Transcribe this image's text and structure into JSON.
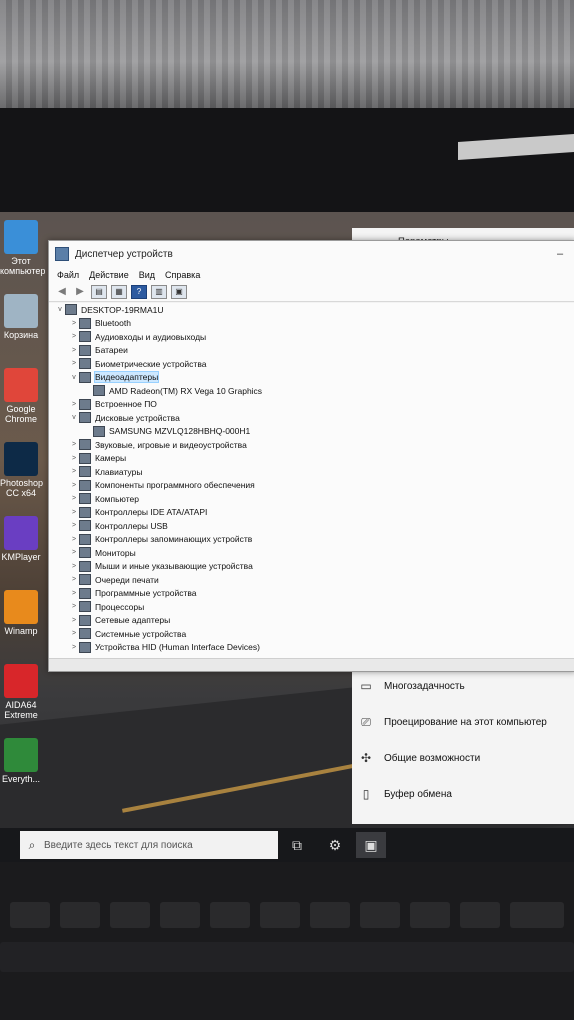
{
  "desktop": {
    "icons": [
      {
        "label": "Этот компьютер",
        "icon": "computer-icon",
        "color": "#3a8fd8"
      },
      {
        "label": "Корзина",
        "icon": "recycle-bin-icon",
        "color": "#9fb4c4"
      },
      {
        "label": "Google Chrome",
        "icon": "chrome-icon",
        "color": "#e0463a"
      },
      {
        "label": "Photoshop CC x64",
        "icon": "photoshop-icon",
        "color": "#0d2a47"
      },
      {
        "label": "KMPlayer",
        "icon": "kmplayer-icon",
        "color": "#6a3ec2"
      },
      {
        "label": "Winamp",
        "icon": "winamp-icon",
        "color": "#e88a1c"
      },
      {
        "label": "AIDA64 Extreme",
        "icon": "aida64-icon",
        "color": "#d8262a"
      },
      {
        "label": "Everyth...",
        "icon": "everything-icon",
        "color": "#2f8a3a"
      }
    ]
  },
  "device_manager": {
    "title": "Диспетчер устройств",
    "menu": [
      "Файл",
      "Действие",
      "Вид",
      "Справка"
    ],
    "root": "DESKTOP-19RMA1U",
    "tree": [
      {
        "label": "Bluetooth",
        "expander": ">",
        "indent": 1
      },
      {
        "label": "Аудиовходы и аудиовыходы",
        "expander": ">",
        "indent": 1
      },
      {
        "label": "Батареи",
        "expander": ">",
        "indent": 1
      },
      {
        "label": "Биометрические устройства",
        "expander": ">",
        "indent": 1
      },
      {
        "label": "Видеоадаптеры",
        "expander": "v",
        "indent": 1,
        "selected": true
      },
      {
        "label": "AMD Radeon(TM) RX Vega 10 Graphics",
        "expander": "",
        "indent": 2
      },
      {
        "label": "Встроенное ПО",
        "expander": ">",
        "indent": 1
      },
      {
        "label": "Дисковые устройства",
        "expander": "v",
        "indent": 1
      },
      {
        "label": "SAMSUNG MZVLQ128HBHQ-000H1",
        "expander": "",
        "indent": 2
      },
      {
        "label": "Звуковые, игровые и видеоустройства",
        "expander": ">",
        "indent": 1
      },
      {
        "label": "Камеры",
        "expander": ">",
        "indent": 1
      },
      {
        "label": "Клавиатуры",
        "expander": ">",
        "indent": 1
      },
      {
        "label": "Компоненты программного обеспечения",
        "expander": ">",
        "indent": 1
      },
      {
        "label": "Компьютер",
        "expander": ">",
        "indent": 1
      },
      {
        "label": "Контроллеры IDE ATA/ATAPI",
        "expander": ">",
        "indent": 1
      },
      {
        "label": "Контроллеры USB",
        "expander": ">",
        "indent": 1
      },
      {
        "label": "Контроллеры запоминающих устройств",
        "expander": ">",
        "indent": 1
      },
      {
        "label": "Мониторы",
        "expander": ">",
        "indent": 1
      },
      {
        "label": "Мыши и иные указывающие устройства",
        "expander": ">",
        "indent": 1
      },
      {
        "label": "Очереди печати",
        "expander": ">",
        "indent": 1
      },
      {
        "label": "Программные устройства",
        "expander": ">",
        "indent": 1
      },
      {
        "label": "Процессоры",
        "expander": ">",
        "indent": 1
      },
      {
        "label": "Сетевые адаптеры",
        "expander": ">",
        "indent": 1
      },
      {
        "label": "Системные устройства",
        "expander": ">",
        "indent": 1
      },
      {
        "label": "Устройства HID (Human Interface Devices)",
        "expander": ">",
        "indent": 1
      }
    ]
  },
  "settings": {
    "title": "Параметры",
    "items": [
      {
        "label": "Многозадачность",
        "icon": "multitasking-icon"
      },
      {
        "label": "Проецирование на этот компьютер",
        "icon": "projecting-icon"
      },
      {
        "label": "Общие возможности",
        "icon": "shared-experiences-icon"
      },
      {
        "label": "Буфер обмена",
        "icon": "clipboard-icon"
      }
    ]
  },
  "taskbar": {
    "search_placeholder": "Введите здесь текст для поиска"
  },
  "colors": {
    "selection": "#cde8ff",
    "taskbar": "#17181b"
  }
}
